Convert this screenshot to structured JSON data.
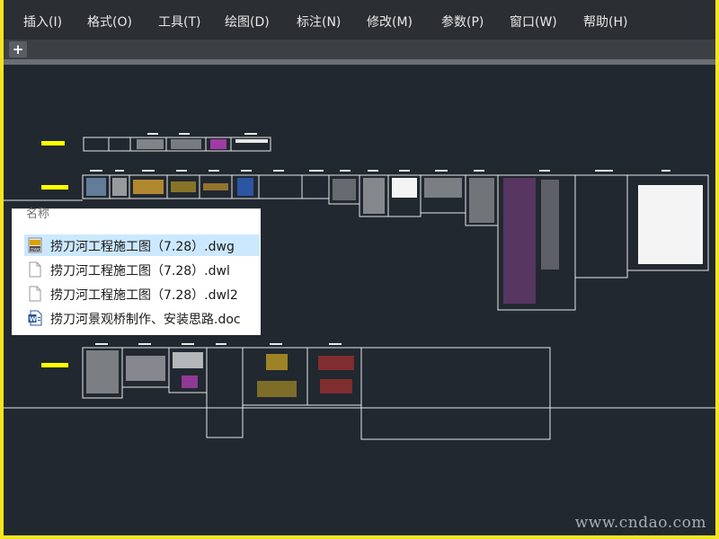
{
  "menubar": {
    "items": [
      "插入(I)",
      "格式(O)",
      "工具(T)",
      "绘图(D)",
      "标注(N)",
      "修改(M)",
      "参数(P)",
      "窗口(W)",
      "帮助(H)"
    ]
  },
  "tabstrip": {
    "add_label": "+"
  },
  "file_panel": {
    "column_header": "名称",
    "files": [
      {
        "name": "捞刀河工程施工图（7.28）.dwg",
        "icon": "dwg-file-icon",
        "selected": true
      },
      {
        "name": "捞刀河工程施工图（7.28）.dwl",
        "icon": "blank-file-icon",
        "selected": false
      },
      {
        "name": "捞刀河工程施工图（7.28）.dwl2",
        "icon": "blank-file-icon",
        "selected": false
      },
      {
        "name": "捞刀河景观桥制作、安装思路.doc",
        "icon": "word-file-icon",
        "selected": false
      }
    ]
  },
  "watermark": "www.cndao.com",
  "colors": {
    "frame": "#f5e51e",
    "menubar": "#2b2e33",
    "canvas": "#212830",
    "selection": "#cce8ff",
    "cad_label": "#ffff00"
  }
}
